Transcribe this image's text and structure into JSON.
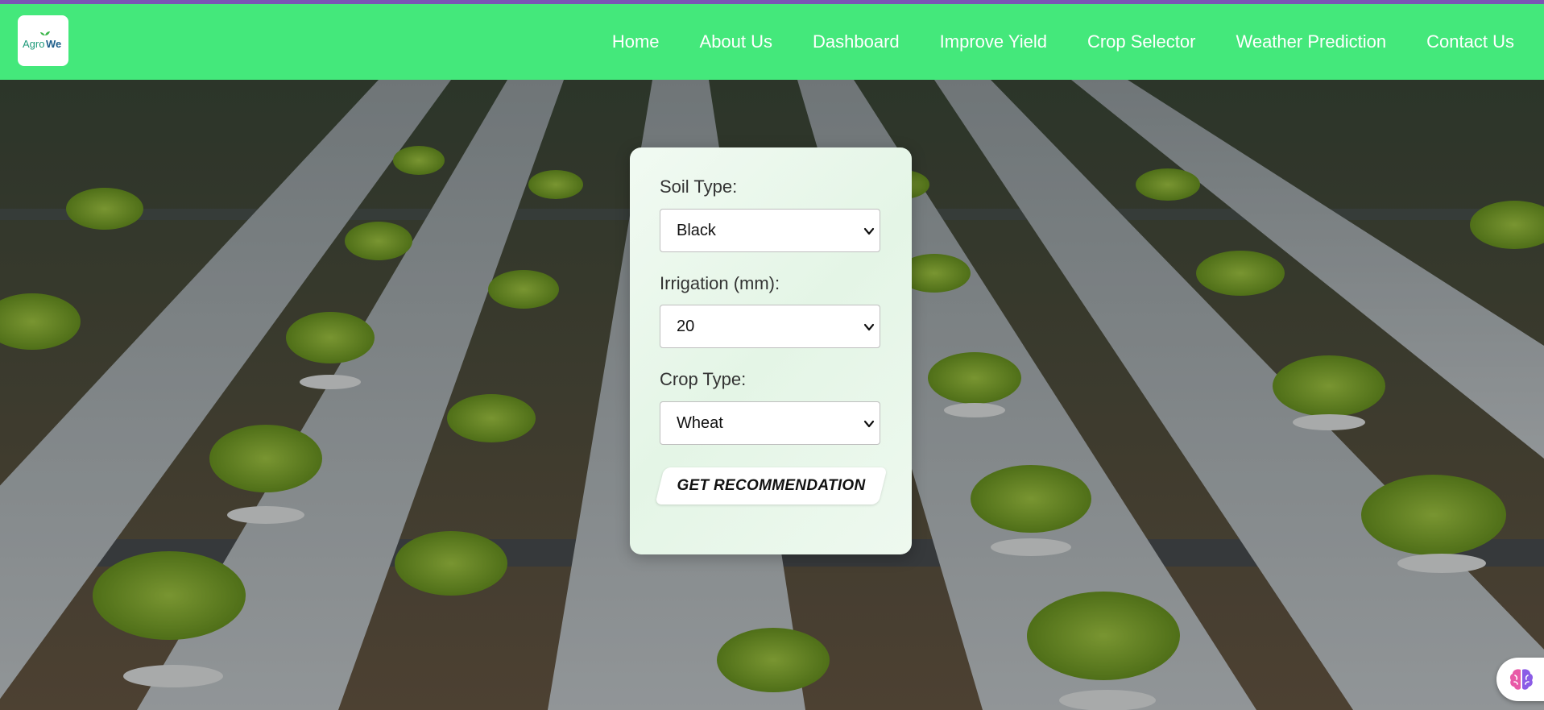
{
  "brand": {
    "logo_text": "AgroWe",
    "colors": {
      "navbar": "#44e87b",
      "top_stripe": "#7b54b5",
      "logo_agro": "#1f9a7a",
      "logo_we": "#1f5f8b"
    }
  },
  "nav": {
    "items": [
      {
        "label": "Home"
      },
      {
        "label": "About Us"
      },
      {
        "label": "Dashboard"
      },
      {
        "label": "Improve Yield"
      },
      {
        "label": "Crop Selector"
      },
      {
        "label": "Weather Prediction"
      },
      {
        "label": "Contact Us"
      }
    ]
  },
  "form": {
    "soil": {
      "label": "Soil Type:",
      "value": "Black"
    },
    "irrigation": {
      "label": "Irrigation (mm):",
      "value": "20"
    },
    "crop": {
      "label": "Crop Type:",
      "value": "Wheat"
    },
    "submit_label": "GET RECOMMENDATION"
  },
  "icons": {
    "select_arrow": "chevron-down-icon",
    "assistant": "brain-icon"
  }
}
